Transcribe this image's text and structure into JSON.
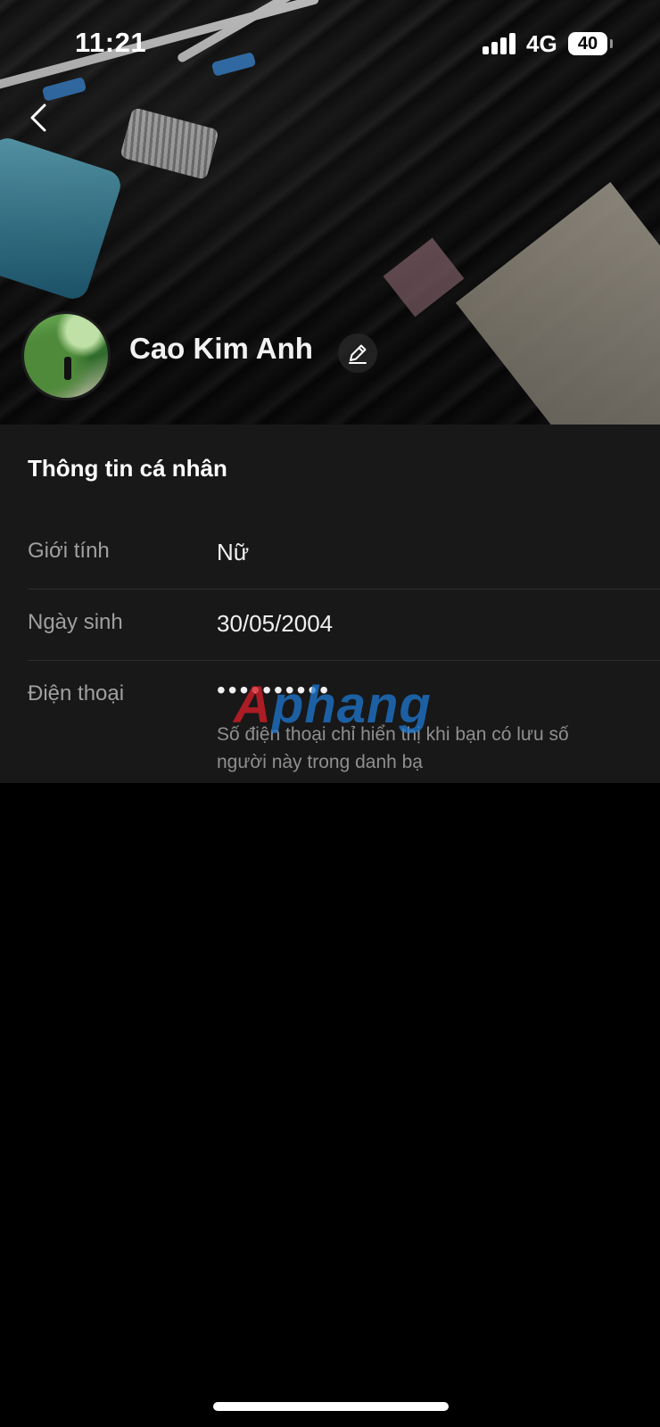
{
  "status_bar": {
    "time": "11:21",
    "network": "4G",
    "battery": "40"
  },
  "profile": {
    "name": "Cao Kim Anh"
  },
  "personal_info": {
    "title": "Thông tin cá nhân",
    "rows": [
      {
        "label": "Giới tính",
        "value": "Nữ"
      },
      {
        "label": "Ngày sinh",
        "value": "30/05/2004"
      },
      {
        "label": "Điện thoại",
        "value": "••••••••••",
        "note": "Số điện thoại chỉ hiển thị khi bạn có lưu số người này trong danh bạ"
      }
    ]
  },
  "watermark": {
    "first": "A",
    "rest": "phang"
  },
  "icons": {
    "back": "chevron-left-icon",
    "edit": "pencil-icon",
    "signal": "cellular-signal-icon",
    "battery": "battery-icon"
  }
}
